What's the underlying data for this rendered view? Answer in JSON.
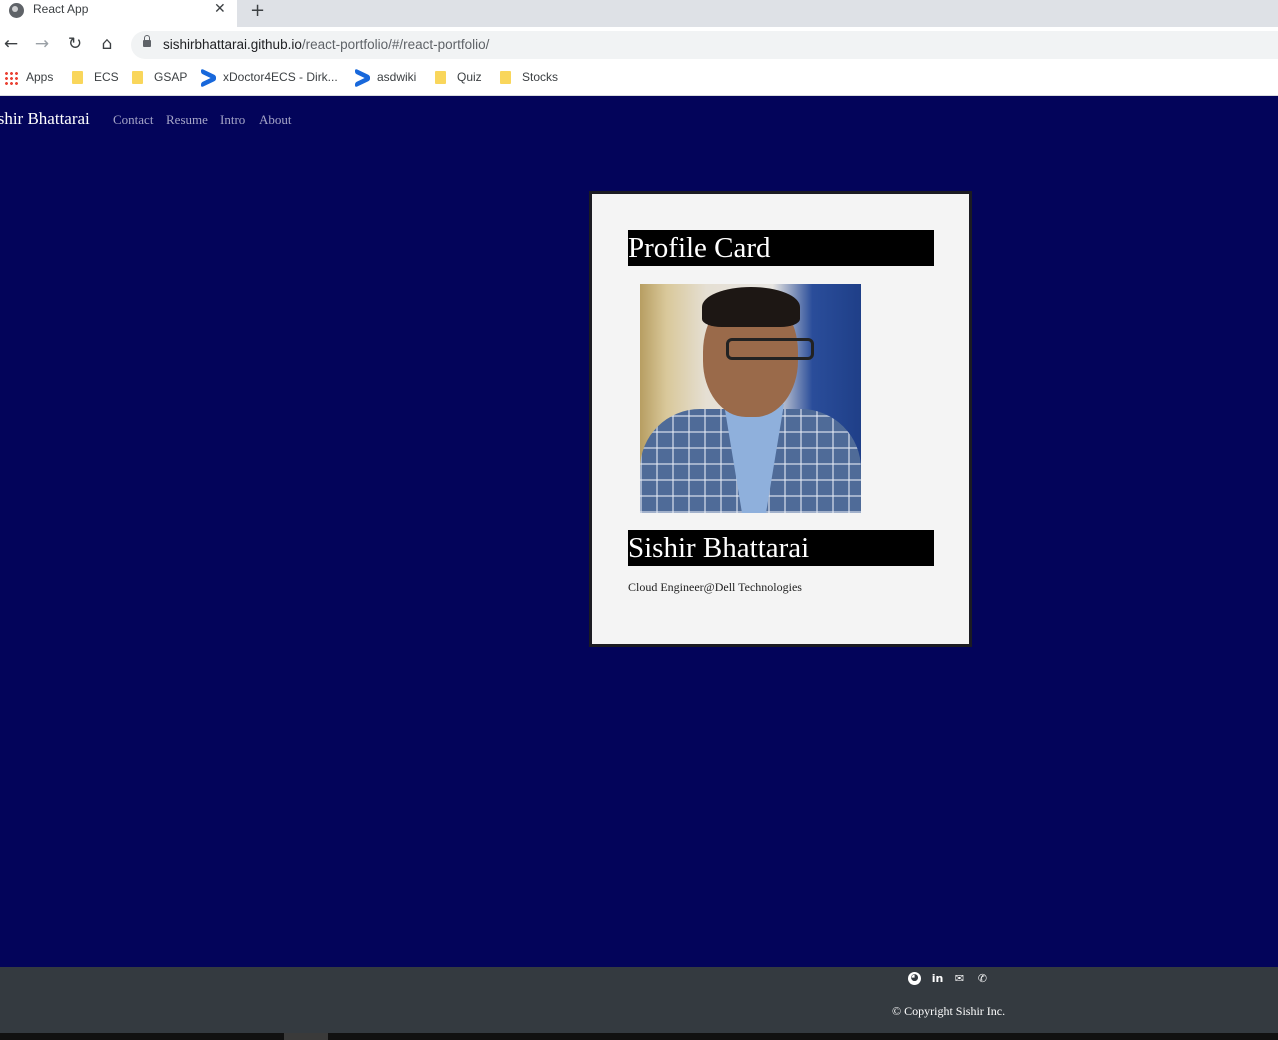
{
  "browser": {
    "tab_title": "React App",
    "tab_close": "✕",
    "new_tab": "+",
    "url_host": "sishirbhattarai.github.io",
    "url_path": "/react-portfolio/#/react-portfolio/",
    "bookmarks": [
      {
        "label": "Apps",
        "icon": "apps-grid-icon"
      },
      {
        "label": "ECS",
        "icon": "folder-icon"
      },
      {
        "label": "GSAP",
        "icon": "folder-icon"
      },
      {
        "label": "xDoctor4ECS - Dirk...",
        "icon": "confluence-icon"
      },
      {
        "label": "asdwiki",
        "icon": "confluence-icon"
      },
      {
        "label": "Quiz",
        "icon": "folder-icon"
      },
      {
        "label": "Stocks",
        "icon": "folder-icon"
      }
    ]
  },
  "navbar": {
    "brand": "ishir Bhattarai",
    "links": [
      "Contact",
      "Resume",
      "Intro",
      "About"
    ]
  },
  "card": {
    "header": "Profile Card",
    "name": "Sishir Bhattarai",
    "subtitle": "Cloud Engineer@Dell Technologies"
  },
  "footer": {
    "icons": [
      "github-icon",
      "linkedin-icon",
      "envelope-icon",
      "phone-icon"
    ],
    "copyright": "© Copyright Sishir Inc."
  },
  "colors": {
    "page_background": "#03045a",
    "footer_background": "#343a40",
    "card_background": "#f4f4f4",
    "banner_background": "#000000"
  }
}
